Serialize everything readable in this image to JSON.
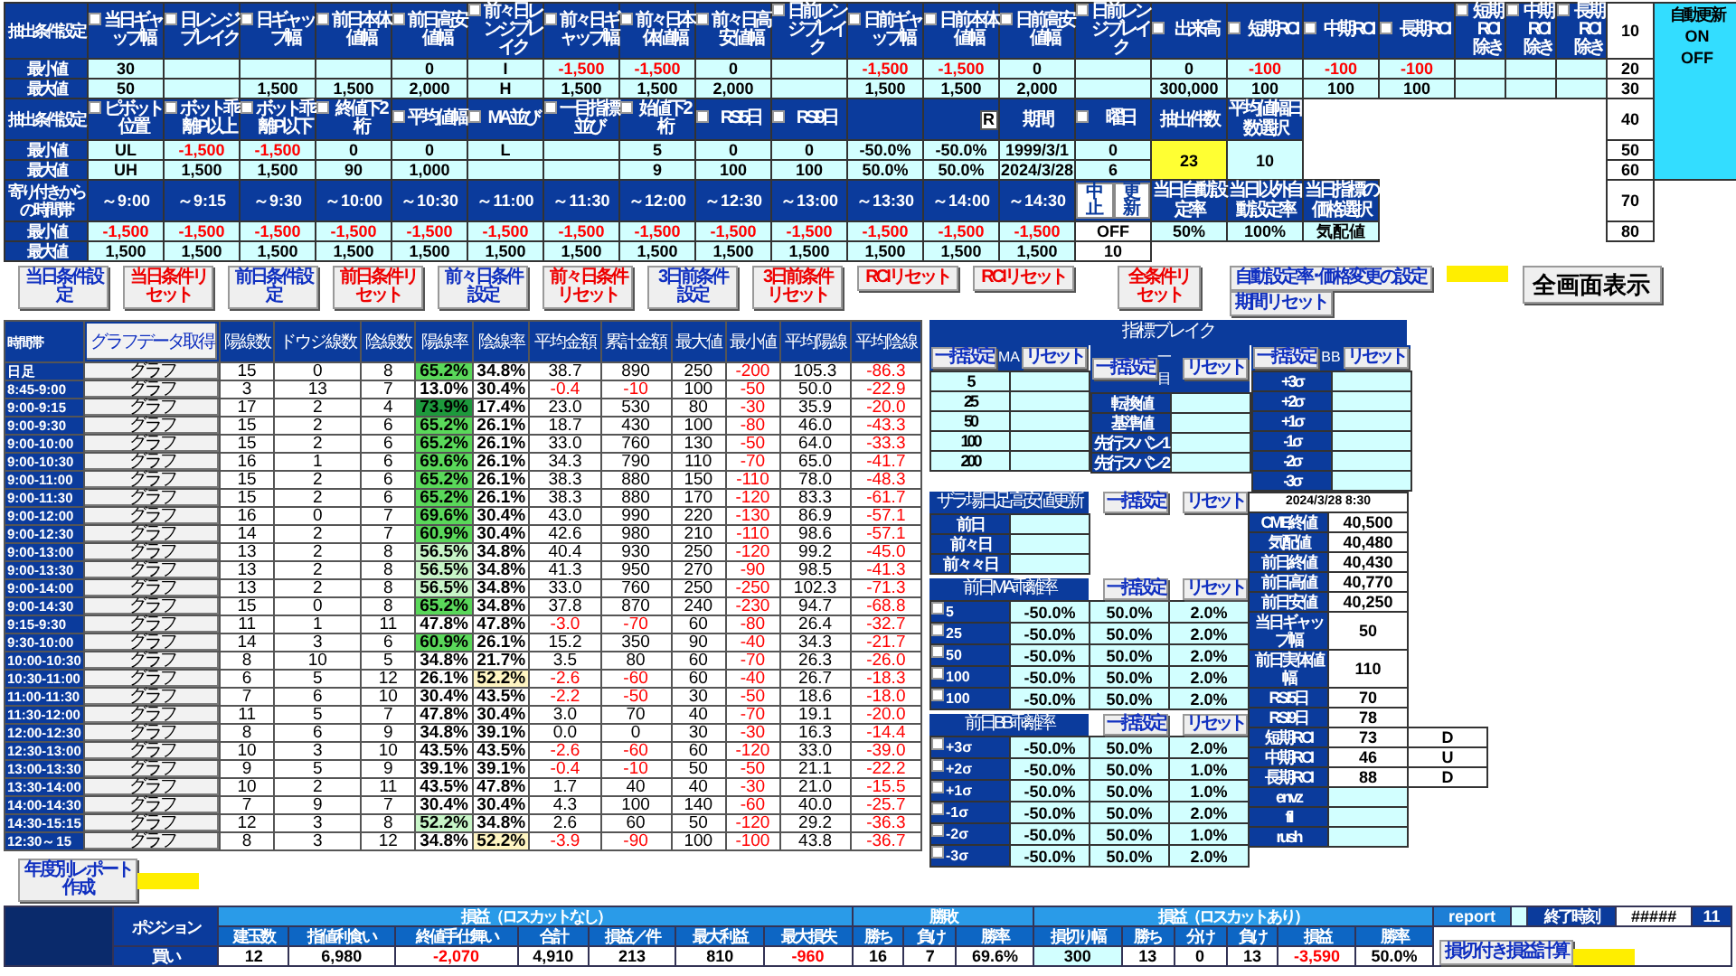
{
  "extract_conditions_1": {
    "label": "抽出条件設定",
    "row_labels": [
      "最小値",
      "最大値"
    ],
    "columns": [
      {
        "kind": "check",
        "header": "当日ギャップ幅",
        "checked": false,
        "min": "30",
        "max": "50"
      },
      {
        "kind": "check",
        "header": "日レンジブレイク",
        "checked": false
      },
      {
        "kind": "check",
        "header": "日ギャップ幅",
        "checked": false,
        "max": "1,500"
      },
      {
        "kind": "check",
        "header": "前日本体値幅",
        "checked": false,
        "max": "1,500"
      },
      {
        "kind": "check",
        "header": "前日高安値幅",
        "checked": false,
        "min": "0",
        "max": "2,000"
      },
      {
        "kind": "check",
        "header": "前々日レンジブレイク",
        "checked": false,
        "min": "I",
        "max": "H"
      },
      {
        "kind": "check",
        "header": "前々日ギャップ幅",
        "checked": false,
        "min": "-1,500",
        "max": "1,500"
      },
      {
        "kind": "check",
        "header": "前々日本体値幅",
        "checked": false,
        "min": "-1,500",
        "max": "1,500"
      },
      {
        "kind": "check",
        "header": "前々日高安値幅",
        "checked": false,
        "min": "0",
        "max": "2,000"
      },
      {
        "kind": "check",
        "header": "日前レンジブレイク",
        "checked": false
      },
      {
        "kind": "check",
        "header": "日前ギャップ幅",
        "checked": false,
        "min": "-1,500",
        "max": "1,500"
      },
      {
        "kind": "check",
        "header": "日前本体値幅",
        "checked": false,
        "min": "-1,500",
        "max": "1,500"
      },
      {
        "kind": "check",
        "header": "日前高安値幅",
        "checked": false,
        "min": "0",
        "max": "2,000"
      },
      {
        "kind": "check",
        "header": "日前レンジブレイク",
        "checked": false
      },
      {
        "kind": "check",
        "header": "出来高",
        "checked": false,
        "min": "0",
        "max": "300,000"
      },
      {
        "kind": "check",
        "header": "短期RCI",
        "checked": false,
        "min": "-100",
        "max": "100"
      },
      {
        "kind": "check",
        "header": "中期RCI",
        "checked": false,
        "min": "-100",
        "max": "100"
      },
      {
        "kind": "check",
        "header": "長期RCI",
        "checked": false,
        "min": "-100",
        "max": "100"
      },
      {
        "kind": "check",
        "header": "短期RCI除き",
        "checked": false
      },
      {
        "kind": "check",
        "header": "中期RCI除き",
        "checked": false
      },
      {
        "kind": "check",
        "header": "長期RCI除き",
        "checked": false
      }
    ]
  },
  "extract_conditions_2": {
    "label": "抽出条件設定",
    "row_labels": [
      "最小値",
      "最大値"
    ],
    "columns": [
      {
        "kind": "check",
        "header": "ピボット位置",
        "checked": false,
        "min": "UL",
        "max": "UH"
      },
      {
        "kind": "check",
        "header": "ボット乖離P以上",
        "checked": false,
        "min": "-1,500",
        "max": "1,500"
      },
      {
        "kind": "check",
        "header": "ボット乖離P以下",
        "checked": false,
        "min": "-1,500",
        "max": "1,500"
      },
      {
        "kind": "check",
        "header": "終値下2桁",
        "checked": false,
        "min": "0",
        "max": "90"
      },
      {
        "kind": "check",
        "header": "平均値幅",
        "checked": false,
        "min": "0",
        "max": "1,000"
      },
      {
        "kind": "check",
        "header": "MA並び",
        "checked": false,
        "min": "L"
      },
      {
        "kind": "check",
        "header": "一目指標並び",
        "checked": false
      },
      {
        "kind": "check",
        "header": "始値下2桁",
        "checked": false,
        "min": "5",
        "max": "9"
      },
      {
        "kind": "check",
        "header": "RSI5日",
        "checked": false,
        "min": "0",
        "max": "100"
      },
      {
        "kind": "check",
        "header": "RSI9日",
        "checked": false,
        "min": "0",
        "max": "100"
      },
      {
        "kind": "empty",
        "min": "-50.0%",
        "max": "50.0%"
      },
      {
        "kind": "rbox",
        "header": "R",
        "min": "-50.0%",
        "max": "50.0%"
      },
      {
        "kind": "plain",
        "header": "期間",
        "min": "1999/3/1",
        "max": "2024/3/28"
      },
      {
        "kind": "check",
        "header": "曜日",
        "checked": false,
        "min": "0",
        "max": "6"
      },
      {
        "kind": "merged",
        "header": "抽出件数",
        "value": "23",
        "highlight": true
      },
      {
        "kind": "merged",
        "header": "平均値幅日数選択",
        "value": "10",
        "highlight": false
      }
    ]
  },
  "time_windows": {
    "label": "寄り付きからの 時間帯",
    "row_labels": [
      "最小値",
      "最大値"
    ],
    "columns": [
      {
        "header": "～9:00",
        "min": "-1,500",
        "max": "1,500"
      },
      {
        "header": "～9:15",
        "min": "-1,500",
        "max": "1,500"
      },
      {
        "header": "～9:30",
        "min": "-1,500",
        "max": "1,500"
      },
      {
        "header": "～10:00",
        "min": "-1,500",
        "max": "1,500"
      },
      {
        "header": "～10:30",
        "min": "-1,500",
        "max": "1,500"
      },
      {
        "header": "～11:00",
        "min": "-1,500",
        "max": "1,500"
      },
      {
        "header": "～11:30",
        "min": "-1,500",
        "max": "1,500"
      },
      {
        "header": "～12:00",
        "min": "-1,500",
        "max": "1,500"
      },
      {
        "header": "～12:30",
        "min": "-1,500",
        "max": "1,500"
      },
      {
        "header": "～13:00",
        "min": "-1,500",
        "max": "1,500"
      },
      {
        "header": "～13:30",
        "min": "-1,500",
        "max": "1,500"
      },
      {
        "header": "～14:00",
        "min": "-1,500",
        "max": "1,500"
      },
      {
        "header": "～14:30",
        "min": "-1,500",
        "max": "1,500"
      }
    ],
    "controls": {
      "buttons": [
        "中止",
        "更新"
      ],
      "min": "OFF",
      "max": "10"
    },
    "rates": [
      {
        "header": "当日自動設定率",
        "value": "50%"
      },
      {
        "header": "当日以外自動設定率",
        "value": "100%"
      },
      {
        "header": "当日指標の価格選択",
        "value": "気配値"
      }
    ]
  },
  "side_values": [
    "10",
    "20",
    "30",
    "40",
    "50",
    "60",
    "70",
    "80"
  ],
  "auto_update": {
    "title": "自動更新",
    "options": [
      "ON",
      "OFF"
    ]
  },
  "condition_buttons": [
    {
      "label": "当日条件設定",
      "kind": "setting"
    },
    {
      "label": "当日条件リセット",
      "kind": "reset"
    },
    {
      "label": "前日条件設定",
      "kind": "setting"
    },
    {
      "label": "前日条件リセット",
      "kind": "reset"
    },
    {
      "label": "前々日条件設定",
      "kind": "setting"
    },
    {
      "label": "前々日条件リセット",
      "kind": "reset"
    },
    {
      "label": "3日前条件設定",
      "kind": "setting"
    },
    {
      "label": "3日前条件リセット",
      "kind": "reset"
    }
  ],
  "rci_buttons": [
    {
      "label": "RCIリセット",
      "kind": "reset"
    },
    {
      "label": "RCIリセット",
      "kind": "reset"
    }
  ],
  "all_reset_button": {
    "label": "全条件リセット",
    "kind": "reset"
  },
  "rate_setting_button": "自動設定率･価格変更の設定",
  "period_reset_button": "期間リセット",
  "fullscreen_button": "全画面表示",
  "time_table": {
    "corner": "時間帯",
    "graph_data_button": "グラフデータ取得",
    "headers": [
      "陽線数",
      "ドウジ線数",
      "陰線数",
      "陽線率",
      "陰線率",
      "平均金額",
      "累計金額",
      "最大値",
      "最小値",
      "平均陽線",
      "平均陰線"
    ],
    "rows": [
      {
        "label": "日足",
        "graph": "グラフ",
        "values": [
          "15",
          "0",
          "8",
          "65.2%",
          "34.8%",
          "38.7",
          "890",
          "250",
          "-200",
          "105.3",
          "-86.3"
        ],
        "rate_fills": [
          {
            "color": "#5ad85a"
          },
          {
            "color": "#ffffff"
          }
        ]
      },
      {
        "label": "8:45-9:00",
        "graph": "グラフ",
        "values": [
          "3",
          "13",
          "7",
          "13.0%",
          "30.4%",
          "-0.4",
          "-10",
          "100",
          "-50",
          "50.0",
          "-22.9"
        ],
        "rate_fills": [
          {
            "color": "#ffffff"
          },
          {
            "color": "#ffffff"
          }
        ]
      },
      {
        "label": "9:00-9:15",
        "graph": "グラフ",
        "values": [
          "17",
          "2",
          "4",
          "73.9%",
          "17.4%",
          "23.0",
          "530",
          "80",
          "-30",
          "35.9",
          "-20.0"
        ],
        "rate_fills": [
          {
            "color": "#1d9a3c"
          },
          {
            "color": "#ffffff"
          }
        ]
      },
      {
        "label": "9:00-9:30",
        "graph": "グラフ",
        "values": [
          "15",
          "2",
          "6",
          "65.2%",
          "26.1%",
          "18.7",
          "430",
          "100",
          "-80",
          "46.0",
          "-43.3"
        ],
        "rate_fills": [
          {
            "color": "#5ad85a"
          },
          {
            "color": "#ffffff"
          }
        ]
      },
      {
        "label": "9:00-10:00",
        "graph": "グラフ",
        "values": [
          "15",
          "2",
          "6",
          "65.2%",
          "26.1%",
          "33.0",
          "760",
          "130",
          "-50",
          "64.0",
          "-33.3"
        ],
        "rate_fills": [
          {
            "color": "#5ad85a"
          },
          {
            "color": "#ffffff"
          }
        ]
      },
      {
        "label": "9:00-10:30",
        "graph": "グラフ",
        "values": [
          "16",
          "1",
          "6",
          "69.6%",
          "26.1%",
          "34.3",
          "790",
          "110",
          "-70",
          "65.0",
          "-41.7"
        ],
        "rate_fills": [
          {
            "color": "#5ad85a"
          },
          {
            "color": "#ffffff"
          }
        ]
      },
      {
        "label": "9:00-11:00",
        "graph": "グラフ",
        "values": [
          "15",
          "2",
          "6",
          "65.2%",
          "26.1%",
          "38.3",
          "880",
          "150",
          "-110",
          "78.0",
          "-48.3"
        ],
        "rate_fills": [
          {
            "color": "#5ad85a"
          },
          {
            "color": "#ffffff"
          }
        ]
      },
      {
        "label": "9:00-11:30",
        "graph": "グラフ",
        "values": [
          "15",
          "2",
          "6",
          "65.2%",
          "26.1%",
          "38.3",
          "880",
          "170",
          "-120",
          "83.3",
          "-61.7"
        ],
        "rate_fills": [
          {
            "color": "#5ad85a"
          },
          {
            "color": "#ffffff"
          }
        ]
      },
      {
        "label": "9:00-12:00",
        "graph": "グラフ",
        "values": [
          "16",
          "0",
          "7",
          "69.6%",
          "30.4%",
          "43.0",
          "990",
          "220",
          "-130",
          "86.9",
          "-57.1"
        ],
        "rate_fills": [
          {
            "color": "#5ad85a"
          },
          {
            "color": "#ffffff"
          }
        ]
      },
      {
        "label": "9:00-12:30",
        "graph": "グラフ",
        "values": [
          "14",
          "2",
          "7",
          "60.9%",
          "30.4%",
          "42.6",
          "980",
          "210",
          "-110",
          "98.6",
          "-57.1"
        ],
        "rate_fills": [
          {
            "color": "#5ad85a"
          },
          {
            "color": "#ffffff"
          }
        ]
      },
      {
        "label": "9:00-13:00",
        "graph": "グラフ",
        "values": [
          "13",
          "2",
          "8",
          "56.5%",
          "34.8%",
          "40.4",
          "930",
          "250",
          "-120",
          "99.2",
          "-45.0"
        ],
        "rate_fills": [
          {
            "color": "#c8f5c8"
          },
          {
            "color": "#ffffff"
          }
        ]
      },
      {
        "label": "9:00-13:30",
        "graph": "グラフ",
        "values": [
          "13",
          "2",
          "8",
          "56.5%",
          "34.8%",
          "41.3",
          "950",
          "270",
          "-90",
          "98.5",
          "-41.3"
        ],
        "rate_fills": [
          {
            "color": "#c8f5c8"
          },
          {
            "color": "#ffffff"
          }
        ]
      },
      {
        "label": "9:00-14:00",
        "graph": "グラフ",
        "values": [
          "13",
          "2",
          "8",
          "56.5%",
          "34.8%",
          "33.0",
          "760",
          "250",
          "-250",
          "102.3",
          "-71.3"
        ],
        "rate_fills": [
          {
            "color": "#c8f5c8"
          },
          {
            "color": "#ffffff"
          }
        ]
      },
      {
        "label": "9:00-14:30",
        "graph": "グラフ",
        "values": [
          "15",
          "0",
          "8",
          "65.2%",
          "34.8%",
          "37.8",
          "870",
          "240",
          "-230",
          "94.7",
          "-68.8"
        ],
        "rate_fills": [
          {
            "color": "#5ad85a"
          },
          {
            "color": "#ffffff"
          }
        ]
      },
      {
        "label": "9:15-9:30",
        "graph": "グラフ",
        "values": [
          "11",
          "1",
          "11",
          "47.8%",
          "47.8%",
          "-3.0",
          "-70",
          "60",
          "-80",
          "26.4",
          "-32.7"
        ],
        "rate_fills": [
          {
            "color": "#ffffff"
          },
          {
            "color": "#ffffff"
          }
        ]
      },
      {
        "label": "9:30-10:00",
        "graph": "グラフ",
        "values": [
          "14",
          "3",
          "6",
          "60.9%",
          "26.1%",
          "15.2",
          "350",
          "90",
          "-40",
          "34.3",
          "-21.7"
        ],
        "rate_fills": [
          {
            "color": "#5ad85a"
          },
          {
            "color": "#ffffff"
          }
        ]
      },
      {
        "label": "10:00-10:30",
        "graph": "グラフ",
        "values": [
          "8",
          "10",
          "5",
          "34.8%",
          "21.7%",
          "3.5",
          "80",
          "60",
          "-70",
          "26.3",
          "-26.0"
        ],
        "rate_fills": [
          {
            "color": "#ffffff"
          },
          {
            "color": "#ffffff"
          }
        ]
      },
      {
        "label": "10:30-11:00",
        "graph": "グラフ",
        "values": [
          "6",
          "5",
          "12",
          "26.1%",
          "52.2%",
          "-2.6",
          "-60",
          "60",
          "-40",
          "26.7",
          "-18.3"
        ],
        "rate_fills": [
          {
            "color": "#ffffff"
          },
          {
            "color": "#fff5c2"
          }
        ]
      },
      {
        "label": "11:00-11:30",
        "graph": "グラフ",
        "values": [
          "7",
          "6",
          "10",
          "30.4%",
          "43.5%",
          "-2.2",
          "-50",
          "30",
          "-50",
          "18.6",
          "-18.0"
        ],
        "rate_fills": [
          {
            "color": "#ffffff"
          },
          {
            "color": "#ffffff"
          }
        ]
      },
      {
        "label": "11:30-12:00",
        "graph": "グラフ",
        "values": [
          "11",
          "5",
          "7",
          "47.8%",
          "30.4%",
          "3.0",
          "70",
          "40",
          "-70",
          "19.1",
          "-20.0"
        ],
        "rate_fills": [
          {
            "color": "#ffffff"
          },
          {
            "color": "#ffffff"
          }
        ]
      },
      {
        "label": "12:00-12:30",
        "graph": "グラフ",
        "values": [
          "8",
          "6",
          "9",
          "34.8%",
          "39.1%",
          "0.0",
          "0",
          "30",
          "-30",
          "16.3",
          "-14.4"
        ],
        "rate_fills": [
          {
            "color": "#ffffff"
          },
          {
            "color": "#ffffff"
          }
        ]
      },
      {
        "label": "12:30-13:00",
        "graph": "グラフ",
        "values": [
          "10",
          "3",
          "10",
          "43.5%",
          "43.5%",
          "-2.6",
          "-60",
          "60",
          "-120",
          "33.0",
          "-39.0"
        ],
        "rate_fills": [
          {
            "color": "#ffffff"
          },
          {
            "color": "#ffffff"
          }
        ]
      },
      {
        "label": "13:00-13:30",
        "graph": "グラフ",
        "values": [
          "9",
          "5",
          "9",
          "39.1%",
          "39.1%",
          "-0.4",
          "-10",
          "50",
          "-50",
          "21.1",
          "-22.2"
        ],
        "rate_fills": [
          {
            "color": "#ffffff"
          },
          {
            "color": "#ffffff"
          }
        ]
      },
      {
        "label": "13:30-14:00",
        "graph": "グラフ",
        "values": [
          "10",
          "2",
          "11",
          "43.5%",
          "47.8%",
          "1.7",
          "40",
          "40",
          "-30",
          "21.0",
          "-15.5"
        ],
        "rate_fills": [
          {
            "color": "#ffffff"
          },
          {
            "color": "#ffffff"
          }
        ]
      },
      {
        "label": "14:00-14:30",
        "graph": "グラフ",
        "values": [
          "7",
          "9",
          "7",
          "30.4%",
          "30.4%",
          "4.3",
          "100",
          "140",
          "-60",
          "40.0",
          "-25.7"
        ],
        "rate_fills": [
          {
            "color": "#ffffff"
          },
          {
            "color": "#ffffff"
          }
        ]
      },
      {
        "label": "14:30-15:15",
        "graph": "グラフ",
        "values": [
          "12",
          "3",
          "8",
          "52.2%",
          "34.8%",
          "2.6",
          "60",
          "50",
          "-120",
          "29.2",
          "-36.3"
        ],
        "rate_fills": [
          {
            "color": "#c8f5c8"
          },
          {
            "color": "#ffffff"
          }
        ]
      },
      {
        "label": "12:30～15",
        "graph": "グラフ",
        "values": [
          "8",
          "3",
          "12",
          "34.8%",
          "52.2%",
          "-3.9",
          "-90",
          "100",
          "-100",
          "43.8",
          "-36.7"
        ],
        "rate_fills": [
          {
            "color": "#ffffff"
          },
          {
            "color": "#fff5c2"
          }
        ]
      }
    ]
  },
  "indicator_break": {
    "title": "指標ブレイク",
    "blocks": [
      {
        "kind": "period",
        "set": "一括設定",
        "name": "MA",
        "reset": "リセット",
        "rows": [
          "5",
          "25",
          "50",
          "100",
          "200"
        ]
      },
      {
        "kind": "line",
        "set": "一括設定",
        "name": "一目",
        "reset": "リセット",
        "rows": [
          "転換値",
          "基準値",
          "先行スパン1",
          "先行スパン2"
        ]
      },
      {
        "kind": "line",
        "set": "一括設定",
        "name": "BB",
        "reset": "リセット",
        "rows": [
          "+3σ",
          "+2σ",
          "+1σ",
          "-1σ",
          "-2σ",
          "-3σ"
        ]
      }
    ]
  },
  "intraday_high_low": {
    "title": "ザラ場日足高安値更新",
    "set": "一括設定",
    "reset": "リセット",
    "rows": [
      "前日",
      "前々日",
      "前々々日"
    ]
  },
  "ma_deviation": {
    "title": "前日MA乖離率",
    "set": "一括設定",
    "reset": "リセット",
    "rows": [
      {
        "label": "5",
        "checked": false,
        "values": [
          "-50.0%",
          "50.0%",
          "2.0%"
        ]
      },
      {
        "label": "25",
        "checked": false,
        "values": [
          "-50.0%",
          "50.0%",
          "2.0%"
        ]
      },
      {
        "label": "50",
        "checked": false,
        "values": [
          "-50.0%",
          "50.0%",
          "2.0%"
        ]
      },
      {
        "label": "100",
        "checked": false,
        "values": [
          "-50.0%",
          "50.0%",
          "2.0%"
        ]
      },
      {
        "label": "100",
        "checked": false,
        "values": [
          "-50.0%",
          "50.0%",
          "2.0%"
        ]
      }
    ]
  },
  "bb_deviation": {
    "title": "前日BB乖離率",
    "set": "一括設定",
    "reset": "リセット",
    "rows": [
      {
        "label": "+3σ",
        "checked": false,
        "values": [
          "-50.0%",
          "50.0%",
          "2.0%"
        ]
      },
      {
        "label": "+2σ",
        "checked": false,
        "values": [
          "-50.0%",
          "50.0%",
          "1.0%"
        ]
      },
      {
        "label": "+1σ",
        "checked": false,
        "values": [
          "-50.0%",
          "50.0%",
          "1.0%"
        ]
      },
      {
        "label": "-1σ",
        "checked": false,
        "values": [
          "-50.0%",
          "50.0%",
          "2.0%"
        ]
      },
      {
        "label": "-2σ",
        "checked": false,
        "values": [
          "-50.0%",
          "50.0%",
          "1.0%"
        ]
      },
      {
        "label": "-3σ",
        "checked": false,
        "values": [
          "-50.0%",
          "50.0%",
          "2.0%"
        ]
      }
    ]
  },
  "market_info": {
    "timestamp": "2024/3/28 8:30",
    "rows": [
      {
        "label": "CME終値",
        "value": "40,500"
      },
      {
        "label": "気配値",
        "value": "40,480"
      },
      {
        "label": "前日終値",
        "value": "40,430"
      },
      {
        "label": "前日高値",
        "value": "40,770"
      },
      {
        "label": "前日安値",
        "value": "40,250"
      },
      {
        "label": "当日ギャップ幅",
        "value": "50"
      },
      {
        "label": "前日実体値幅",
        "value": "110"
      },
      {
        "label": "RSI5日",
        "value": "70"
      },
      {
        "label": "RSI9日",
        "value": "78"
      },
      {
        "label": "短期RCI",
        "value": "73",
        "trend": "D"
      },
      {
        "label": "中期RCI",
        "value": "46",
        "trend": "U"
      },
      {
        "label": "長期RCI",
        "value": "88",
        "trend": "D"
      },
      {
        "label": "envz"
      },
      {
        "label": "fil"
      },
      {
        "label": "rush"
      }
    ]
  },
  "annual_report_button": "年度別レポート作成",
  "position_summary": {
    "label": "ポジション",
    "side": "買い",
    "groups": [
      {
        "title": "損益（ロスカットなし）",
        "columns": [
          {
            "header": "建玉数",
            "value": "12"
          },
          {
            "header": "指値利食い",
            "value": "6,980"
          },
          {
            "header": "終値手仕舞い",
            "value": "-2,070"
          },
          {
            "header": "合計",
            "value": "4,910"
          },
          {
            "header": "損益／件",
            "value": "213"
          },
          {
            "header": "最大利益",
            "value": "810"
          },
          {
            "header": "最大損失",
            "value": "-960"
          }
        ]
      },
      {
        "title": "勝敗",
        "columns": [
          {
            "header": "勝ち",
            "value": "16"
          },
          {
            "header": "負け",
            "value": "7"
          },
          {
            "header": "勝率",
            "value": "69.6%"
          }
        ]
      },
      {
        "title": "損益（ロスカットあり）",
        "columns": [
          {
            "header": "損切り幅",
            "value": "300",
            "input": true
          },
          {
            "header": "勝ち",
            "value": "13"
          },
          {
            "header": "分け",
            "value": "0"
          },
          {
            "header": "負け",
            "value": "13"
          },
          {
            "header": "損益",
            "value": "-3,590"
          },
          {
            "header": "勝率",
            "value": "50.0%"
          }
        ]
      }
    ],
    "report_label": "report",
    "end_time_label": "終了時刻",
    "end_time_value": "#####",
    "end_time_extra": "11",
    "calc_button": "損切付き損益計算"
  }
}
